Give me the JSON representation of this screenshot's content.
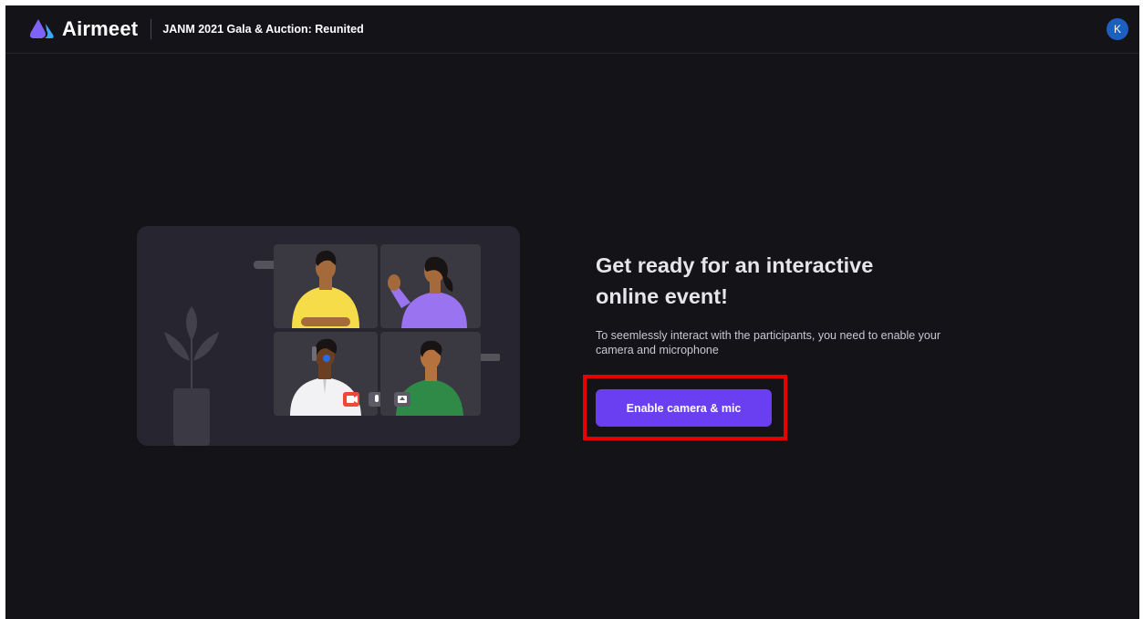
{
  "header": {
    "brand_name": "Airmeet",
    "event_title": "JANM 2021 Gala & Auction: Reunited",
    "avatar_initial": "K",
    "logo_icon": "airmeet-logo-icon"
  },
  "main": {
    "headline": "Get ready for an interactive online event!",
    "description": "To seemlessly interact with the participants, you need to enable your camera and microphone",
    "cta_label": "Enable camera & mic"
  },
  "illustration": {
    "icons": [
      "video-camera-icon",
      "microphone-icon",
      "screen-share-icon"
    ]
  },
  "colors": {
    "background": "#141318",
    "brand_purple": "#6a3ff2",
    "highlight_red": "#e60000",
    "avatar_blue": "#1d5fc1"
  }
}
